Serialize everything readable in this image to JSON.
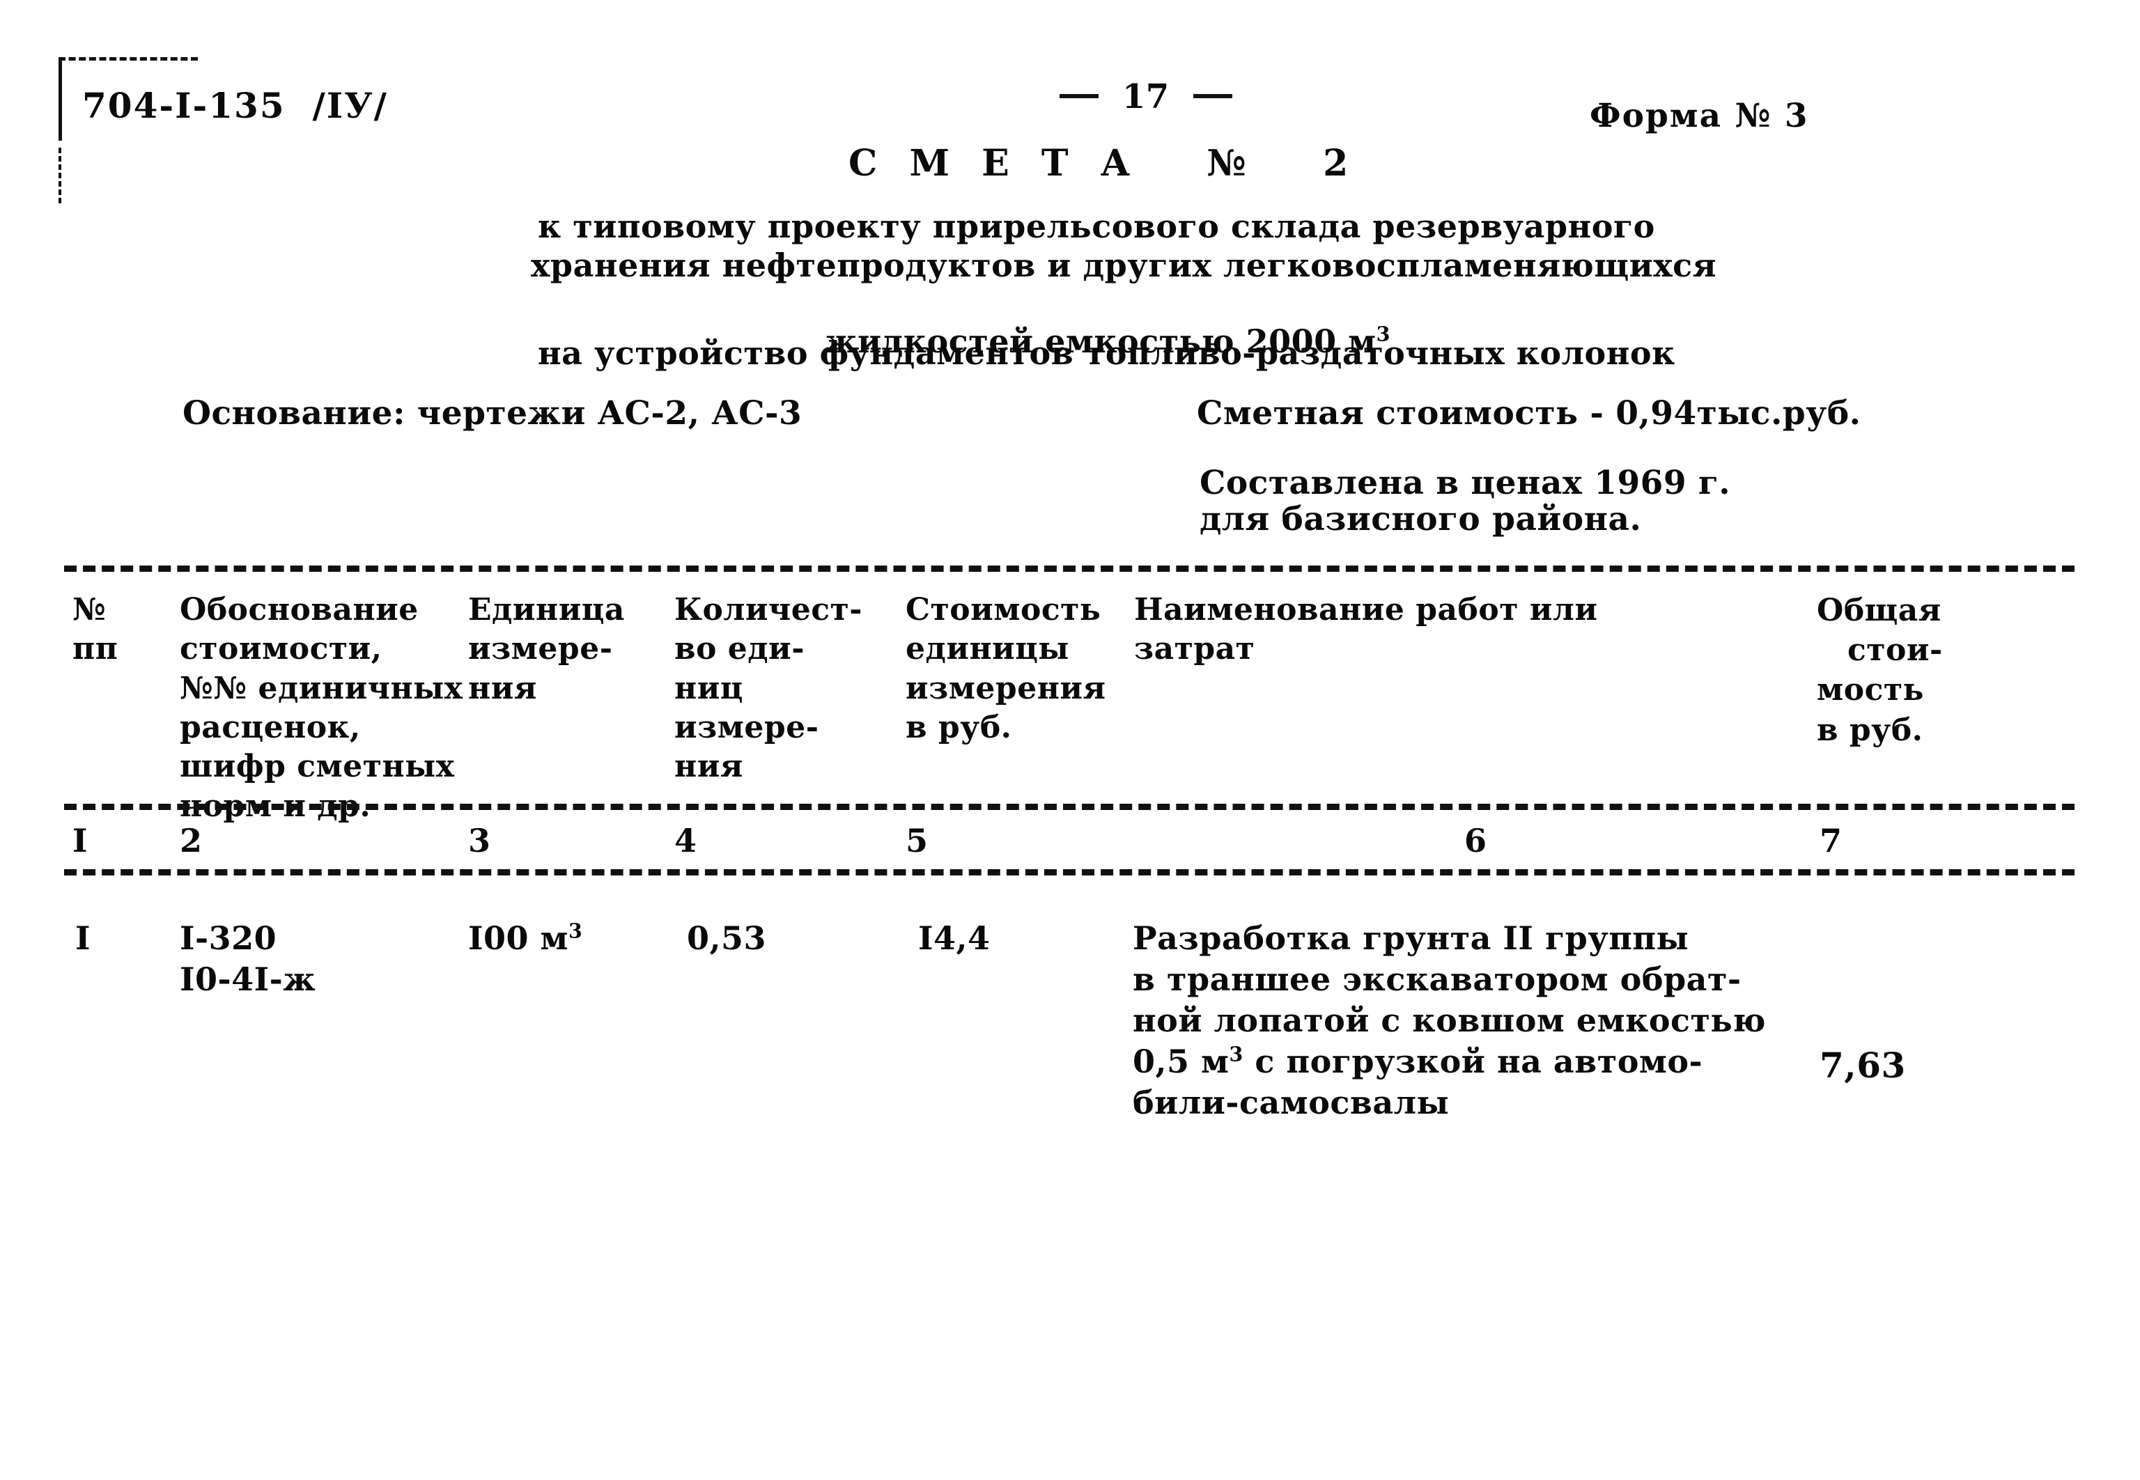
{
  "document": {
    "project_code": "704-I-135  /IУ/",
    "page_number_marker": "17",
    "form_label": "Форма № 3",
    "title": "С М Е Т А   №   2",
    "subtitle_lines": [
      "к типовому проекту прирельсового склада резервуарного",
      "хранения нефтепродуктов и других легковоспламеняющихся",
      "жидкостей емкостью 2000 м"
    ],
    "subtitle_superscript": "3",
    "purpose_line": "на устройство фундаментов топливо-раздаточных колонок",
    "basis_label": "Основание: чертежи АС-2, АС-3",
    "estimate_cost": "Сметная стоимость - 0,94тыс.руб.",
    "prices_line_1": "Составлена в ценах 1969 г.",
    "prices_line_2": "для базисного района."
  },
  "table": {
    "headers": {
      "col1_line1": "№",
      "col1_line2": "пп",
      "col2": "Обоснование\nстоимости,\n№№ единичных\nрасценок,\nшифр сметных\nнорм и др.",
      "col3": "Единица\nизмере-\nния",
      "col4": "Количест-\nво еди-\nниц\nизмере-\nния",
      "col5": "Стоимость\nединицы\nизмерения\nв руб.",
      "col6": "Наименование работ или\nзатрат",
      "col7_line1": "Общая",
      "col7_line2": "стои-",
      "col7_line3": "мость",
      "col7_line4": "в руб."
    },
    "column_numbers": [
      "I",
      "2",
      "3",
      "4",
      "5",
      "6",
      "7"
    ],
    "rows": [
      {
        "num": "I",
        "justification_line1": "I-320",
        "justification_line2": "I0-4I-ж",
        "unit": "I00 м",
        "unit_superscript": "3",
        "quantity": "0,53",
        "unit_cost": "I4,4",
        "description_line1": "Разработка грунта II группы",
        "description_line2": "в траншее экскаватором обрат-",
        "description_line3": "ной лопатой с ковшом емкостью",
        "description_line4_a": "0,5 м",
        "description_line4_sup": "3",
        "description_line4_b": " с погрузкой на автомо-",
        "description_line5": "били-самосвалы",
        "total_cost": "7,63"
      }
    ]
  }
}
